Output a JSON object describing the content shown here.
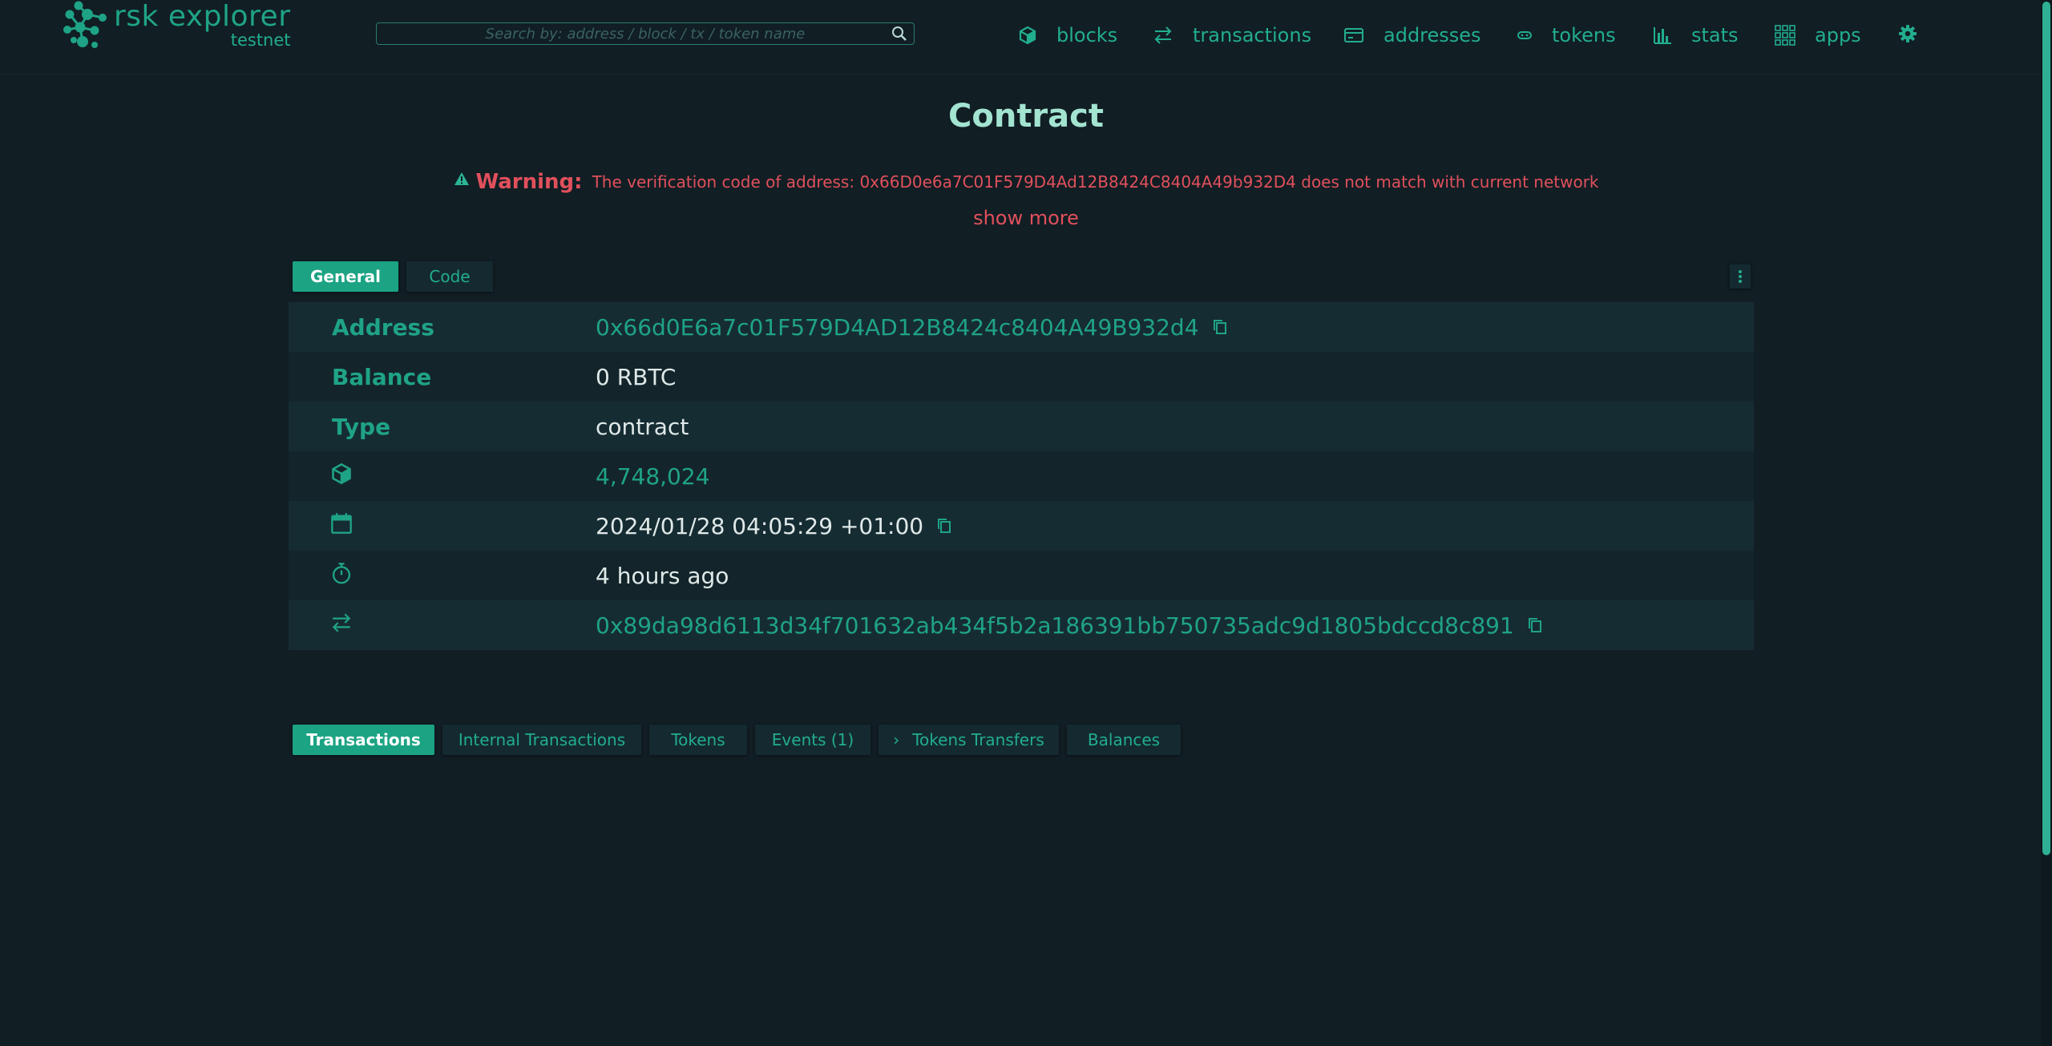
{
  "header": {
    "logo_name": "rsk explorer",
    "logo_network": "testnet",
    "search_placeholder": "Search by: address / block / tx / token name",
    "nav": [
      {
        "label": "blocks",
        "icon": "cube-icon"
      },
      {
        "label": "transactions",
        "icon": "arrows-icon"
      },
      {
        "label": "addresses",
        "icon": "card-icon"
      },
      {
        "label": "tokens",
        "icon": "token-icon"
      },
      {
        "label": "stats",
        "icon": "bar-chart-icon"
      },
      {
        "label": "apps",
        "icon": "grid-icon"
      }
    ],
    "settings_icon": "gear-icon"
  },
  "page": {
    "title": "Contract",
    "warning_label": "Warning:",
    "warning_text": "The verification code of address: 0x66D0e6a7C01F579D4Ad12B8424C8404A49b932D4 does not match with current network",
    "show_more": "show more"
  },
  "top_tabs": [
    {
      "label": "General",
      "active": true
    },
    {
      "label": "Code",
      "active": false
    }
  ],
  "details": {
    "address_label": "Address",
    "address_value": "0x66d0E6a7c01F579D4AD12B8424c8404A49B932d4",
    "balance_label": "Balance",
    "balance_value": "0 RBTC",
    "type_label": "Type",
    "type_value": "contract",
    "block_value": "4,748,024",
    "date_value": "2024/01/28 04:05:29 +01:00",
    "age_value": "4 hours ago",
    "tx_value": "0x89da98d6113d34f701632ab434f5b2a186391bb750735adc9d1805bdccd8c891"
  },
  "bottom_tabs": [
    {
      "label": "Transactions",
      "active": true
    },
    {
      "label": "Internal Transactions",
      "active": false
    },
    {
      "label": "Tokens",
      "active": false
    },
    {
      "label": "Events (1)",
      "active": false
    },
    {
      "label": "Tokens Transfers",
      "active": false
    },
    {
      "label": "Balances",
      "active": false
    }
  ],
  "colors": {
    "background": "#111e24",
    "accent": "#1fa386",
    "warning": "#e0505c",
    "title": "#a3e4d1"
  }
}
